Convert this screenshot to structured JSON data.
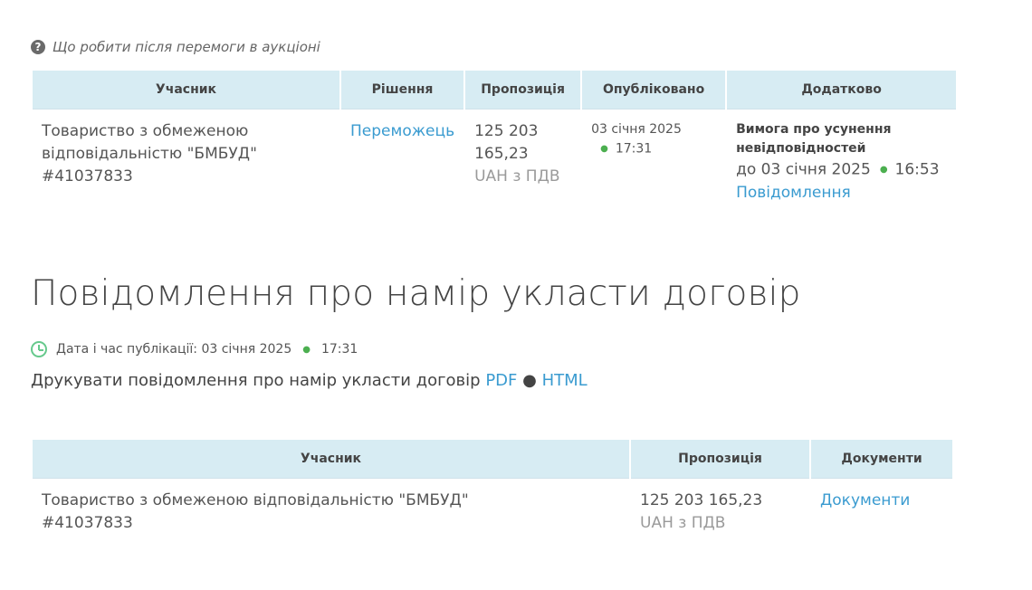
{
  "help": {
    "icon": "question-circle-icon",
    "label": "Що робити після перемоги в аукціоні"
  },
  "results_table": {
    "headers": {
      "participant": "Учасник",
      "decision": "Рішення",
      "offer": "Пропозиція",
      "published": "Опубліковано",
      "additional": "Додатково"
    },
    "row": {
      "participant_line1": "Товариство з обмеженою",
      "participant_line2": "відповідальністю \"БМБУД\"",
      "participant_id": "#41037833",
      "decision": "Переможець",
      "offer_line1": "125 203",
      "offer_line2": "165,23",
      "currency": "UAH з ПДВ",
      "published_date": "03 січня 2025",
      "published_time": "17:31",
      "requirement_title": "Вимога про усунення невідповідностей",
      "deadline_date": "до 03 січня 2025",
      "deadline_time": "16:53",
      "message_link": "Повідомлення"
    }
  },
  "notice": {
    "title": "Повідомлення про намір укласти договір",
    "pub_label": "Дата і час публікації: 03 січня 2025",
    "pub_time": "17:31",
    "print_label": "Друкувати повідомлення про намір укласти договір",
    "pdf_link": "PDF",
    "separator": "●",
    "html_link": "HTML"
  },
  "contract_table": {
    "headers": {
      "participant": "Учасник",
      "offer": "Пропозиція",
      "documents": "Документи"
    },
    "row": {
      "participant_line1": "Товариство з обмеженою відповідальністю \"БМБУД\"",
      "participant_id": "#41037833",
      "offer": "125 203 165,23",
      "currency": "UAH з ПДВ",
      "documents_link": "Документи"
    }
  },
  "colors": {
    "header_bg": "#d7ecf3",
    "link": "#3a9bd0",
    "dot": "#4caf50",
    "clock": "#66c98c"
  }
}
